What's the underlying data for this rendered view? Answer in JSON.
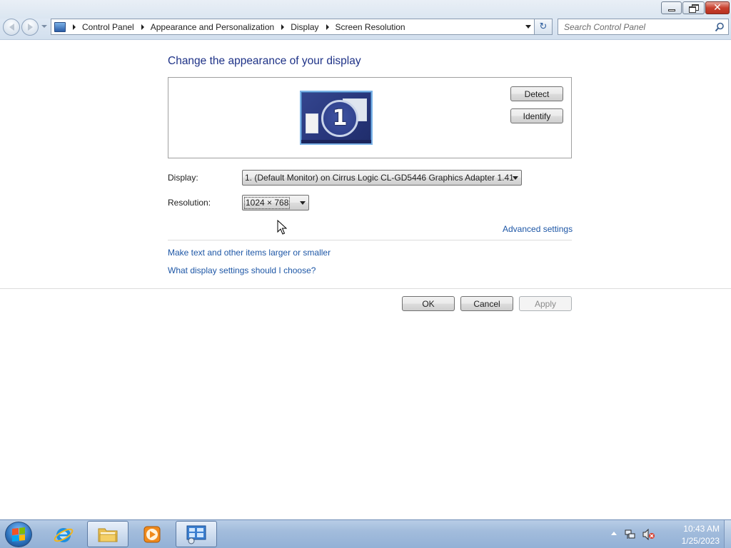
{
  "window": {
    "minimize_icon": "minimize-icon",
    "maximize_icon": "restore-icon",
    "close_icon": "close-icon",
    "close_glyph": "✕"
  },
  "nav": {
    "back_icon": "back-arrow-icon",
    "forward_icon": "forward-arrow-icon",
    "breadcrumbs": [
      "Control Panel",
      "Appearance and Personalization",
      "Display",
      "Screen Resolution"
    ],
    "refresh_glyph": "↻",
    "search_placeholder": "Search Control Panel"
  },
  "content": {
    "title": "Change the appearance of your display",
    "monitor_number": "1",
    "detect_label": "Detect",
    "identify_label": "Identify",
    "display_label": "Display:",
    "display_value": "1. (Default Monitor) on Cirrus Logic CL-GD5446 Graphics Adapter 1.41",
    "resolution_label": "Resolution:",
    "resolution_value": "1024 × 768",
    "advanced_link": "Advanced settings",
    "larger_link": "Make text and other items larger or smaller",
    "choose_link": "What display settings should I choose?",
    "ok_label": "OK",
    "cancel_label": "Cancel",
    "apply_label": "Apply"
  },
  "taskbar": {
    "pinned": [
      "internet-explorer-icon",
      "windows-explorer-icon",
      "windows-media-player-icon",
      "control-panel-icon"
    ],
    "time": "10:43 AM",
    "date": "1/25/2023"
  },
  "colors": {
    "title_blue": "#1e3287",
    "link_blue": "#1e57a6",
    "taskbar": "#a2bcdc"
  }
}
